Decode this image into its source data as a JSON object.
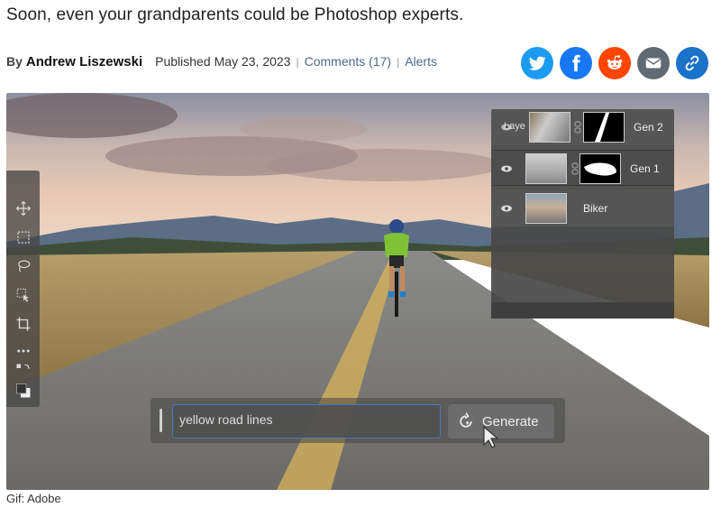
{
  "article": {
    "subtitle": "Soon, even your grandparents could be Photoshop experts.",
    "by": "By",
    "author": "Andrew Liszewski",
    "published": "Published",
    "date": "May 23, 2023",
    "comments": "Comments (17)",
    "alerts": "Alerts",
    "caption": "Gif: Adobe"
  },
  "share": {
    "icons": [
      "twitter-icon",
      "facebook-icon",
      "reddit-icon",
      "email-icon",
      "link-icon"
    ],
    "colors": {
      "twitter": "#1d9bf0",
      "facebook": "#1877f2",
      "reddit": "#ff4500",
      "email": "#5f6a73",
      "link": "#1b72c9"
    }
  },
  "photoshop": {
    "layers_title": "Laye",
    "layers": [
      {
        "name": "Gen 2"
      },
      {
        "name": "Gen 1"
      },
      {
        "name": "Biker"
      }
    ],
    "prompt_value": "yellow road lines",
    "generate_label": "Generate",
    "accent": "#4c79b8"
  }
}
